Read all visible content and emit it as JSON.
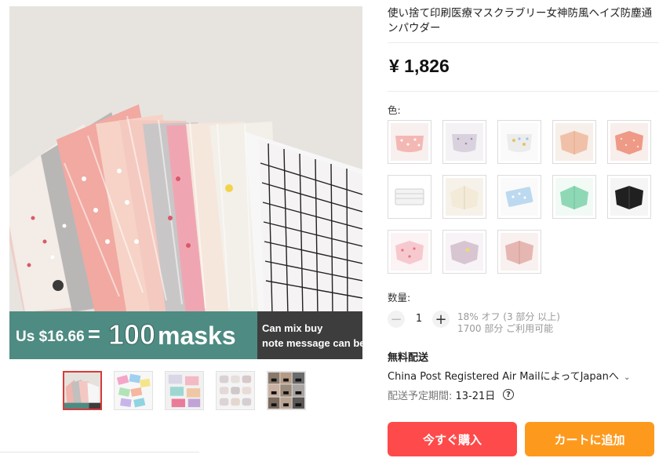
{
  "gallery": {
    "promo": {
      "price": "Us $16.66",
      "equals": "=",
      "quantity": "100",
      "unit": "masks",
      "note_line1": "Can mix buy",
      "note_line2": "note message can be"
    },
    "thumbnails": [
      {
        "name": "pastel-masks-fan",
        "active": true
      },
      {
        "name": "patterned-masks-set",
        "active": false
      },
      {
        "name": "colorful-masks-set",
        "active": false
      },
      {
        "name": "white-masks-grid",
        "active": false
      },
      {
        "name": "people-wearing-masks",
        "active": false
      }
    ]
  },
  "product": {
    "title_line1": "使い捨て印刷医療マスクラブリー女神防風ヘイズ防塵通",
    "title_line2": "ンパウダー",
    "price": "¥ 1,826"
  },
  "color": {
    "label": "色:",
    "options": [
      {
        "icon": "pink-dots-mask",
        "color": "#f4b8b4"
      },
      {
        "icon": "lavender-mask",
        "color": "#d9d2de"
      },
      {
        "icon": "white-floral-mask",
        "color": "#f2f2f2"
      },
      {
        "icon": "peach-mask",
        "color": "#f0c1a8"
      },
      {
        "icon": "coral-pattern-mask",
        "color": "#ee9a86"
      },
      {
        "icon": "white-striped-mask",
        "color": "#f6f6f6"
      },
      {
        "icon": "cream-mask",
        "color": "#f3ead8"
      },
      {
        "icon": "blue-floral-mask",
        "color": "#bcd9ef"
      },
      {
        "icon": "mint-mask",
        "color": "#8fd8b6"
      },
      {
        "icon": "black-mask",
        "color": "#202020"
      },
      {
        "icon": "pink-heart-mask",
        "color": "#f6c9cf"
      },
      {
        "icon": "lilac-mask",
        "color": "#d8c5d2"
      },
      {
        "icon": "rose-mask",
        "color": "#e6b7b2"
      }
    ]
  },
  "quantity": {
    "label": "数量:",
    "minus": "−",
    "value": "1",
    "plus": "+",
    "discount": "18% オフ (3 部分 以上)",
    "available": "1700 部分 ご利用可能"
  },
  "shipping": {
    "title": "無料配送",
    "method": "China Post Registered Air MailによってJapanへ",
    "chevron": "⌄",
    "eta_label": "配送予定期間: ",
    "eta_value": "13-21日",
    "help": "?"
  },
  "actions": {
    "buy_now": "今すぐ購入",
    "add_to_cart": "カートに追加"
  }
}
